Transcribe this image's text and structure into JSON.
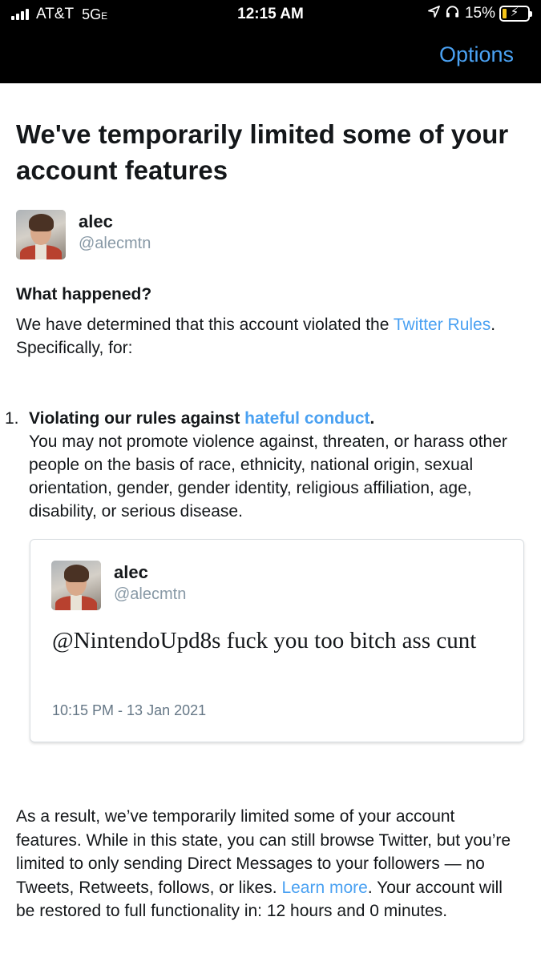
{
  "status_bar": {
    "carrier": "AT&T",
    "network": "5G",
    "network_suffix": "E",
    "time": "12:15 AM",
    "location_icon": "location-arrow-icon",
    "headphones_icon": "headphones-icon",
    "battery_percent": "15%",
    "battery_level": 0.15,
    "battery_color": "#f5c518"
  },
  "nav": {
    "options_label": "Options",
    "accent_color": "#4aa1f2"
  },
  "page": {
    "title": "We've temporarily limited some of your account features"
  },
  "account": {
    "name": "alec",
    "handle": "@alecmtn"
  },
  "what_happened": {
    "heading": "What happened?",
    "text_before": "We have determined that this account violated the ",
    "rules_link": "Twitter Rules",
    "text_after": ". Specifically, for:"
  },
  "violation": {
    "number": "1.",
    "title_prefix": "Violating our rules against ",
    "title_link": "hateful conduct",
    "title_suffix": ".",
    "description": "You may not promote violence against, threaten, or harass other people on the basis of race, ethnicity, national origin, sexual orientation, gender, gender identity, religious affiliation, age, disability, or serious disease."
  },
  "tweet": {
    "name": "alec",
    "handle": "@alecmtn",
    "text": "@NintendoUpd8s fuck you too bitch ass cunt",
    "timestamp": "10:15 PM - 13 Jan 2021"
  },
  "result": {
    "text_before": "As a result, we’ve temporarily limited some of your account features. While in this state, you can still browse Twitter, but you’re limited to only sending Direct Messages to your followers — no Tweets, Retweets, follows, or likes. ",
    "learn_more_link": "Learn more",
    "text_after": ". Your account will be restored to full functionality in: 12 hours and 0 minutes."
  }
}
